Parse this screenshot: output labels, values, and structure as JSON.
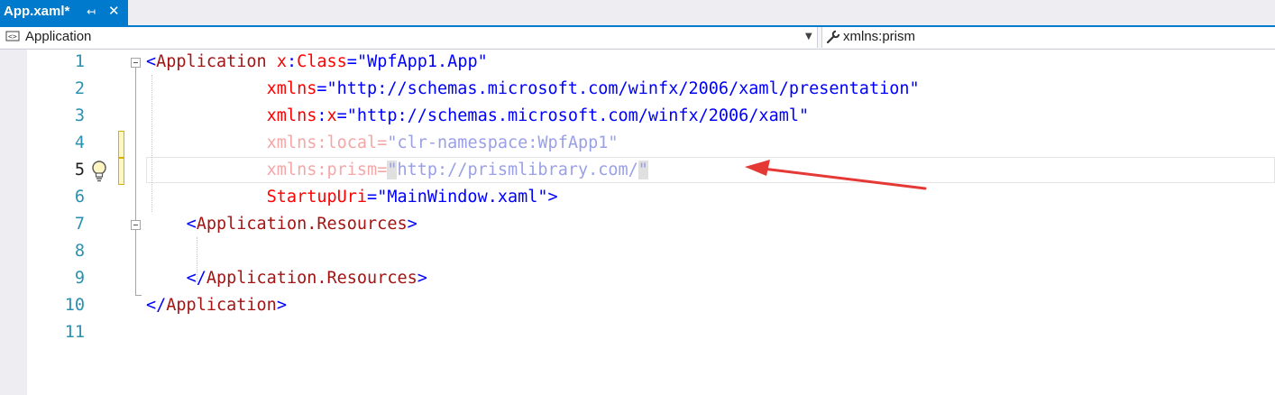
{
  "tab": {
    "title": "App.xaml*",
    "pin_icon": "pin-icon",
    "close_icon": "close-icon"
  },
  "navbar": {
    "left_icon": "xaml-element-icon",
    "left_value": "Application",
    "right_icon": "wrench-icon",
    "right_value": "xmlns:prism"
  },
  "editor": {
    "current_line": 5,
    "lightbulb_icon": "lightbulb-icon",
    "annotation": "red-arrow-pointer",
    "colors": {
      "element": "#a31515",
      "attribute": "#ff0000",
      "value": "#0000ff",
      "line_number": "#2b91af",
      "arrow": "#e53935"
    },
    "lines": [
      {
        "num": "1",
        "tokens": [
          {
            "t": "<",
            "k": "delim"
          },
          {
            "t": "Application",
            "k": "elem"
          },
          {
            "t": " ",
            "k": "ws"
          },
          {
            "t": "x",
            "k": "attr"
          },
          {
            "t": ":",
            "k": "eq"
          },
          {
            "t": "Class",
            "k": "attr"
          },
          {
            "t": "=",
            "k": "eq"
          },
          {
            "t": "\"WpfApp1.App\"",
            "k": "val"
          }
        ]
      },
      {
        "num": "2",
        "tokens": [
          {
            "t": "            ",
            "k": "ws"
          },
          {
            "t": "xmlns",
            "k": "attr"
          },
          {
            "t": "=",
            "k": "eq"
          },
          {
            "t": "\"http://schemas.microsoft.com/winfx/2006/xaml/presentation\"",
            "k": "val"
          }
        ]
      },
      {
        "num": "3",
        "tokens": [
          {
            "t": "            ",
            "k": "ws"
          },
          {
            "t": "xmlns",
            "k": "attr"
          },
          {
            "t": ":",
            "k": "eq"
          },
          {
            "t": "x",
            "k": "attr"
          },
          {
            "t": "=",
            "k": "eq"
          },
          {
            "t": "\"http://schemas.microsoft.com/winfx/2006/xaml\"",
            "k": "val"
          }
        ]
      },
      {
        "num": "4",
        "dim": true,
        "tokens": [
          {
            "t": "            ",
            "k": "ws"
          },
          {
            "t": "xmlns",
            "k": "attr"
          },
          {
            "t": ":",
            "k": "eq"
          },
          {
            "t": "local",
            "k": "attr"
          },
          {
            "t": "=",
            "k": "eq"
          },
          {
            "t": "\"clr-namespace:WpfApp1\"",
            "k": "val"
          }
        ]
      },
      {
        "num": "5",
        "dim": true,
        "tokens": [
          {
            "t": "            ",
            "k": "ws"
          },
          {
            "t": "xmlns",
            "k": "attr"
          },
          {
            "t": ":",
            "k": "eq"
          },
          {
            "t": "prism",
            "k": "attr"
          },
          {
            "t": "=",
            "k": "eq"
          },
          {
            "t": "\"",
            "k": "val",
            "hl": true
          },
          {
            "t": "http://prismlibrary.com/",
            "k": "val"
          },
          {
            "t": "\"",
            "k": "val",
            "hl": true
          }
        ]
      },
      {
        "num": "6",
        "tokens": [
          {
            "t": "            ",
            "k": "ws"
          },
          {
            "t": "StartupUri",
            "k": "attr"
          },
          {
            "t": "=",
            "k": "eq"
          },
          {
            "t": "\"MainWindow.xaml\"",
            "k": "val"
          },
          {
            "t": ">",
            "k": "delim"
          }
        ]
      },
      {
        "num": "7",
        "tokens": [
          {
            "t": "    ",
            "k": "ws"
          },
          {
            "t": "<",
            "k": "delim"
          },
          {
            "t": "Application.Resources",
            "k": "elem"
          },
          {
            "t": ">",
            "k": "delim"
          }
        ]
      },
      {
        "num": "8",
        "tokens": []
      },
      {
        "num": "9",
        "tokens": [
          {
            "t": "    ",
            "k": "ws"
          },
          {
            "t": "</",
            "k": "delim"
          },
          {
            "t": "Application.Resources",
            "k": "elem"
          },
          {
            "t": ">",
            "k": "delim"
          }
        ]
      },
      {
        "num": "10",
        "tokens": [
          {
            "t": "</",
            "k": "delim"
          },
          {
            "t": "Application",
            "k": "elem"
          },
          {
            "t": ">",
            "k": "delim"
          }
        ]
      },
      {
        "num": "11",
        "tokens": []
      }
    ]
  }
}
